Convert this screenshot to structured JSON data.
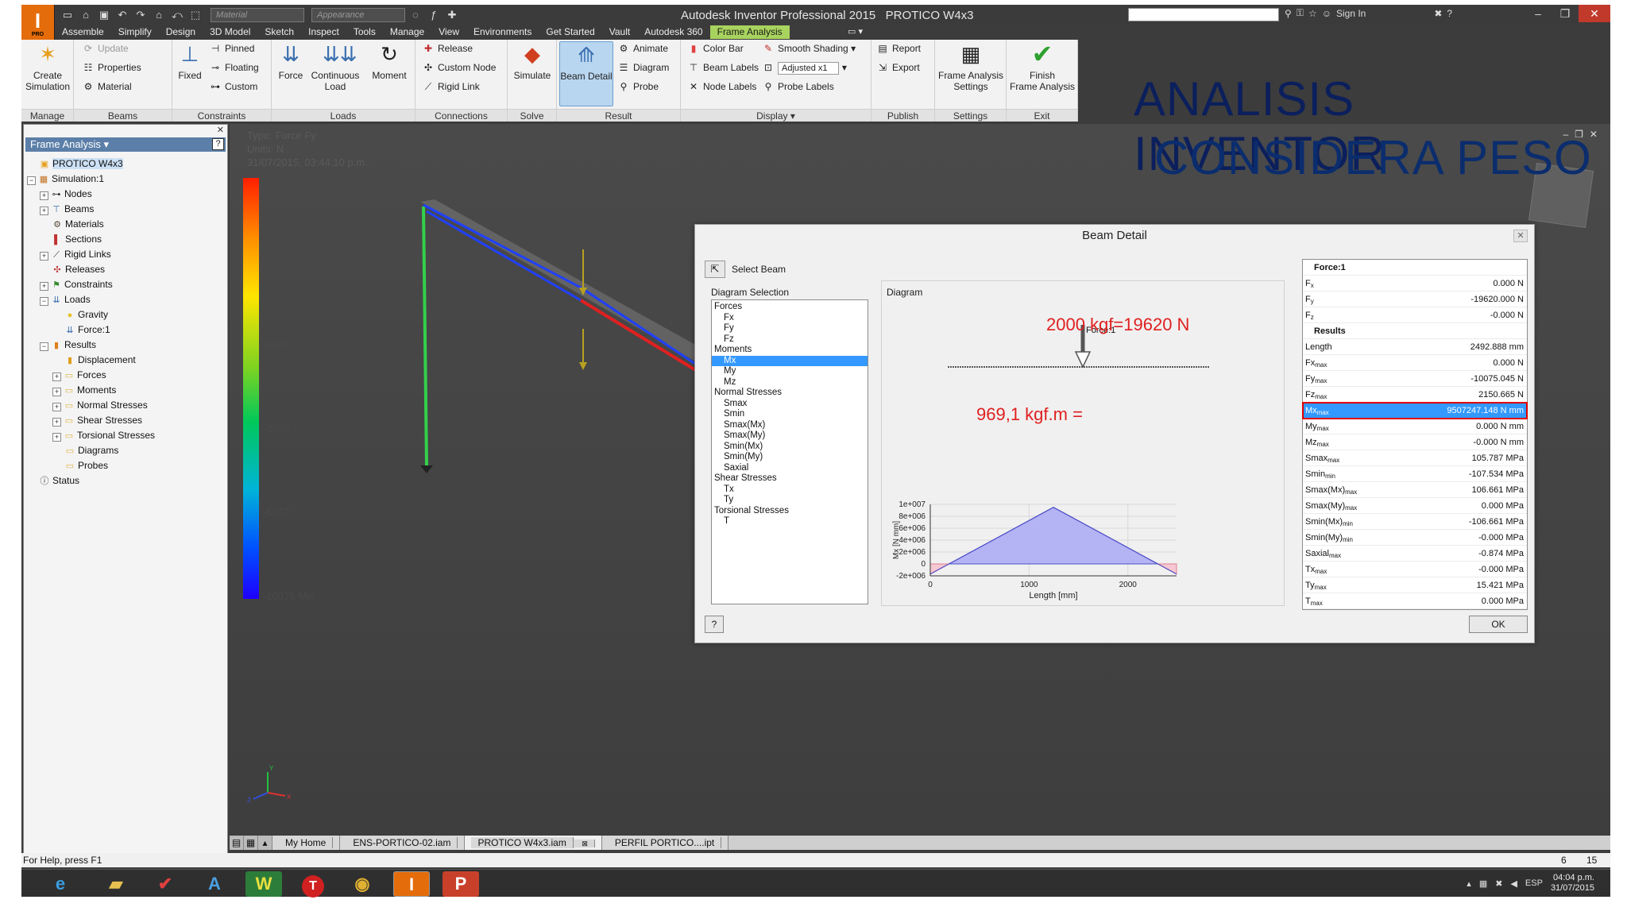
{
  "window": {
    "title": "Autodesk Inventor Professional 2015",
    "document": "PROTICO W4x3",
    "logo": "I",
    "logo_sub": "PRO",
    "material_placeholder": "Material",
    "appearance_placeholder": "Appearance",
    "sign_in": "Sign In"
  },
  "menu_tabs": [
    "Assemble",
    "Simplify",
    "Design",
    "3D Model",
    "Sketch",
    "Inspect",
    "Tools",
    "Manage",
    "View",
    "Environments",
    "Get Started",
    "Vault",
    "Autodesk 360",
    "Frame Analysis"
  ],
  "ribbon": {
    "manage": {
      "title": "Manage",
      "create_simulation": "Create\nSimulation"
    },
    "beams": {
      "title": "Beams",
      "update": "Update",
      "properties": "Properties",
      "material": "Material"
    },
    "constraints": {
      "title": "Constraints",
      "fixed": "Fixed",
      "pinned": "Pinned",
      "floating": "Floating",
      "custom": "Custom"
    },
    "loads": {
      "title": "Loads",
      "force": "Force",
      "continuous_load": "Continuous\nLoad",
      "moment": "Moment"
    },
    "connections": {
      "title": "Connections",
      "release": "Release",
      "custom_node": "Custom Node",
      "rigid_link": "Rigid Link"
    },
    "solve": {
      "title": "Solve",
      "simulate": "Simulate"
    },
    "result": {
      "title": "Result",
      "beam_detail": "Beam Detail",
      "animate": "Animate",
      "diagram": "Diagram",
      "probe": "Probe"
    },
    "display": {
      "title": "Display",
      "color_bar": "Color Bar",
      "smooth_shading": "Smooth Shading",
      "beam_labels": "Beam Labels",
      "adjusted": "Adjusted x1",
      "node_labels": "Node Labels",
      "probe_labels": "Probe Labels"
    },
    "publish": {
      "title": "Publish",
      "report": "Report",
      "export": "Export"
    },
    "settings": {
      "title": "Settings",
      "frame_analysis_settings": "Frame Analysis\nSettings"
    },
    "exit": {
      "title": "Exit",
      "finish": "Finish\nFrame Analysis"
    }
  },
  "banner": {
    "line1": "ANALISIS INVENTOR",
    "line2": "CONSIDERA PESO"
  },
  "browser": {
    "header": "Frame Analysis",
    "help": "?",
    "items": [
      {
        "label": "PROTICO W4x3",
        "level": 0,
        "toggle": "",
        "icon": "assembly-icon",
        "sel": true
      },
      {
        "label": "Simulation:1",
        "level": 0,
        "toggle": "−",
        "icon": "simulation-icon"
      },
      {
        "label": "Nodes",
        "level": 1,
        "toggle": "+",
        "icon": "nodes-icon"
      },
      {
        "label": "Beams",
        "level": 1,
        "toggle": "+",
        "icon": "beams-icon"
      },
      {
        "label": "Materials",
        "level": 1,
        "toggle": "",
        "icon": "materials-icon"
      },
      {
        "label": "Sections",
        "level": 1,
        "toggle": "",
        "icon": "sections-icon"
      },
      {
        "label": "Rigid Links",
        "level": 1,
        "toggle": "+",
        "icon": "rigid-links-icon"
      },
      {
        "label": "Releases",
        "level": 1,
        "toggle": "",
        "icon": "releases-icon"
      },
      {
        "label": "Constraints",
        "level": 1,
        "toggle": "+",
        "icon": "constraints-icon"
      },
      {
        "label": "Loads",
        "level": 1,
        "toggle": "−",
        "icon": "loads-icon"
      },
      {
        "label": "Gravity",
        "level": 2,
        "toggle": "",
        "icon": "gravity-icon"
      },
      {
        "label": "Force:1",
        "level": 2,
        "toggle": "",
        "icon": "force-icon"
      },
      {
        "label": "Results",
        "level": 1,
        "toggle": "−",
        "icon": "results-icon"
      },
      {
        "label": "Displacement",
        "level": 2,
        "toggle": "",
        "icon": "displacement-icon"
      },
      {
        "label": "Forces",
        "level": 2,
        "toggle": "+",
        "icon": "folder-icon"
      },
      {
        "label": "Moments",
        "level": 2,
        "toggle": "+",
        "icon": "folder-icon"
      },
      {
        "label": "Normal Stresses",
        "level": 2,
        "toggle": "+",
        "icon": "folder-icon"
      },
      {
        "label": "Shear Stresses",
        "level": 2,
        "toggle": "+",
        "icon": "folder-icon"
      },
      {
        "label": "Torsional Stresses",
        "level": 2,
        "toggle": "+",
        "icon": "folder-icon"
      },
      {
        "label": "Diagrams",
        "level": 2,
        "toggle": "",
        "icon": "folder-icon"
      },
      {
        "label": "Probes",
        "level": 2,
        "toggle": "",
        "icon": "folder-icon"
      },
      {
        "label": "Status",
        "level": 0,
        "toggle": "",
        "icon": "info-icon"
      }
    ]
  },
  "viewport": {
    "type_line": "Type: Force Fy",
    "units_line": "Units: N",
    "date_line": "31/07/2015, 03:44:10 p.m.",
    "colorbar_labels": [
      "10017 Max",
      "5999",
      "1980",
      "-2038",
      "-6057",
      "-10075 Min"
    ]
  },
  "doc_tabs": [
    "My Home",
    "ENS-PORTICO-02.iam",
    "PROTICO W4x3.iam",
    "PERFIL PORTICO....ipt"
  ],
  "doc_active": "PROTICO W4x3.iam",
  "status": {
    "help": "For Help, press F1",
    "n1": "6",
    "n2": "15"
  },
  "taskbar": {
    "lang": "ESP",
    "time": "04:04 p.m.",
    "date": "31/07/2015"
  },
  "dialog": {
    "title": "Beam Detail",
    "select_beam": "Select Beam",
    "diagram_selection_label": "Diagram Selection",
    "diagram_label": "Diagram",
    "ok": "OK",
    "help": "?",
    "diagram_items": [
      {
        "label": "Forces",
        "sub": false
      },
      {
        "label": "Fx",
        "sub": true
      },
      {
        "label": "Fy",
        "sub": true
      },
      {
        "label": "Fz",
        "sub": true
      },
      {
        "label": "Moments",
        "sub": false
      },
      {
        "label": "Mx",
        "sub": true,
        "sel": true
      },
      {
        "label": "My",
        "sub": true
      },
      {
        "label": "Mz",
        "sub": true
      },
      {
        "label": "Normal Stresses",
        "sub": false
      },
      {
        "label": "Smax",
        "sub": true
      },
      {
        "label": "Smin",
        "sub": true
      },
      {
        "label": "Smax(Mx)",
        "sub": true
      },
      {
        "label": "Smax(My)",
        "sub": true
      },
      {
        "label": "Smin(Mx)",
        "sub": true
      },
      {
        "label": "Smin(My)",
        "sub": true
      },
      {
        "label": "Saxial",
        "sub": true
      },
      {
        "label": "Shear Stresses",
        "sub": false
      },
      {
        "label": "Tx",
        "sub": true
      },
      {
        "label": "Ty",
        "sub": true
      },
      {
        "label": "Torsional Stresses",
        "sub": false
      },
      {
        "label": "T",
        "sub": true
      }
    ],
    "results": [
      {
        "label": "Force:1",
        "value": "",
        "type": "head"
      },
      {
        "label": "F",
        "sub": "x",
        "value": "0.000 N"
      },
      {
        "label": "F",
        "sub": "y",
        "value": "-19620.000 N"
      },
      {
        "label": "F",
        "sub": "z",
        "value": "-0.000 N"
      },
      {
        "label": "Results",
        "value": "",
        "type": "head"
      },
      {
        "label": "Length",
        "sub": "",
        "value": "2492.888 mm"
      },
      {
        "label": "Fx",
        "sub": "max",
        "value": "0.000 N"
      },
      {
        "label": "Fy",
        "sub": "max",
        "value": "-10075.045 N"
      },
      {
        "label": "Fz",
        "sub": "max",
        "value": "2150.665 N"
      },
      {
        "label": "Mx",
        "sub": "max",
        "value": "9507247.148 N mm",
        "hl": true
      },
      {
        "label": "My",
        "sub": "max",
        "value": "0.000 N mm"
      },
      {
        "label": "Mz",
        "sub": "max",
        "value": "-0.000 N mm"
      },
      {
        "label": "Smax",
        "sub": "max",
        "value": "105.787 MPa"
      },
      {
        "label": "Smin",
        "sub": "min",
        "value": "-107.534 MPa"
      },
      {
        "label": "Smax(Mx)",
        "sub": "max",
        "value": "106.661 MPa"
      },
      {
        "label": "Smax(My)",
        "sub": "max",
        "value": "0.000 MPa"
      },
      {
        "label": "Smin(Mx)",
        "sub": "min",
        "value": "-106.661 MPa"
      },
      {
        "label": "Smin(My)",
        "sub": "min",
        "value": "-0.000 MPa"
      },
      {
        "label": "Saxial",
        "sub": "max",
        "value": "-0.874 MPa"
      },
      {
        "label": "Tx",
        "sub": "max",
        "value": "-0.000 MPa"
      },
      {
        "label": "Ty",
        "sub": "max",
        "value": "15.421 MPa"
      },
      {
        "label": "T",
        "sub": "max",
        "value": "0.000 MPa"
      }
    ],
    "annotation_load": "2000 kgf=19620 N",
    "annotation_moment": "969,1 kgf.m =",
    "force_label": "Force:1"
  },
  "chart_data": {
    "type": "area",
    "xlabel": "Length [mm]",
    "ylabel": "Mx [N mm]",
    "xlim": [
      0,
      2492.888
    ],
    "ylim": [
      -2000000,
      10000000
    ],
    "x_ticks": [
      0,
      1000,
      2000
    ],
    "x_tick_labels": [
      "0",
      "1000",
      "2000"
    ],
    "y_ticks": [
      -2000000,
      0,
      2000000,
      4000000,
      6000000,
      8000000,
      10000000
    ],
    "y_tick_labels": [
      "-2e+006",
      "0",
      "2e+006",
      "4e+006",
      "6e+006",
      "8e+006",
      "1e+007"
    ],
    "x": [
      0,
      1246.444,
      2492.888
    ],
    "y": [
      -1700000,
      9507247.148,
      -1700000
    ],
    "grid": true,
    "colors": {
      "positive": "#b4b4f5",
      "negative": "#f5c8d2",
      "line": "#5050c8"
    }
  },
  "colors": {
    "accent": "#a8d35e",
    "selection": "#3399ff",
    "annotation": "#e02020"
  }
}
